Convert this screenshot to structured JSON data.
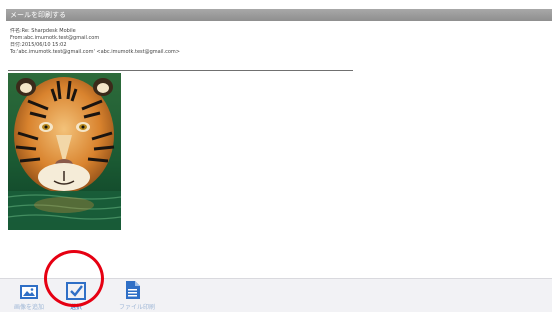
{
  "title_bar": {
    "title": "メールを印刷する"
  },
  "email_header": {
    "subject": "件名:Re: Sharpdesk Mobile",
    "from": "From:abc.imumotk.test@gmail.com",
    "date": "日付:2015/06/10 15:02",
    "to": "To:'abc.imumotk.test@gmail.com' <abc.imumotk.test@gmail.com>"
  },
  "attachment": {
    "subject": "tiger"
  },
  "toolbar": {
    "items": [
      {
        "label": "画像を追加",
        "icon": "image-icon"
      },
      {
        "label": "選択",
        "icon": "checkbox-icon",
        "active": true
      },
      {
        "label": "ファイル印刷",
        "icon": "document-icon"
      }
    ]
  },
  "colors": {
    "title_bar": "#999999",
    "toolbar_bg": "#f2f2f5",
    "icon_blue": "#2f6fc6",
    "callout_red": "#e60012"
  }
}
